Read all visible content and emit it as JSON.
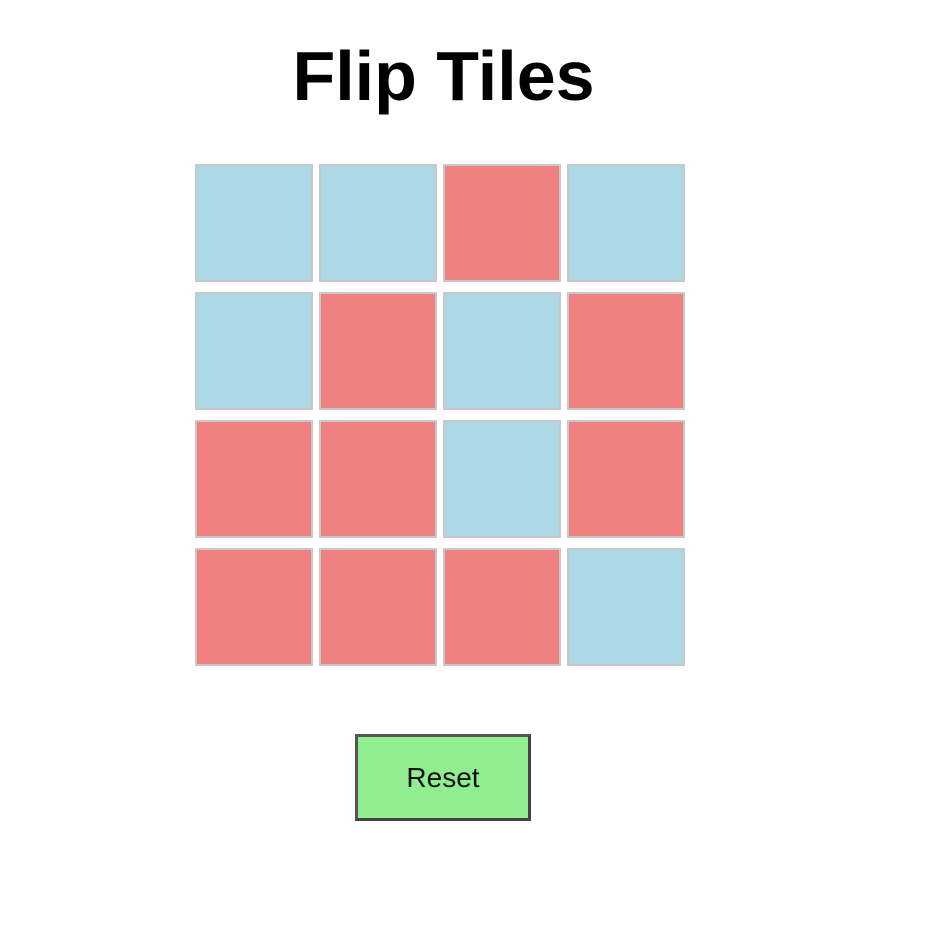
{
  "title": "Flip Tiles",
  "colors": {
    "blue": "#add8e6",
    "red": "#f08080",
    "button": "#90ee90"
  },
  "board": {
    "rows": [
      [
        "blue",
        "blue",
        "red",
        "blue"
      ],
      [
        "blue",
        "red",
        "blue",
        "red"
      ],
      [
        "red",
        "red",
        "blue",
        "red"
      ],
      [
        "red",
        "red",
        "red",
        "blue"
      ]
    ]
  },
  "controls": {
    "reset_label": "Reset"
  }
}
